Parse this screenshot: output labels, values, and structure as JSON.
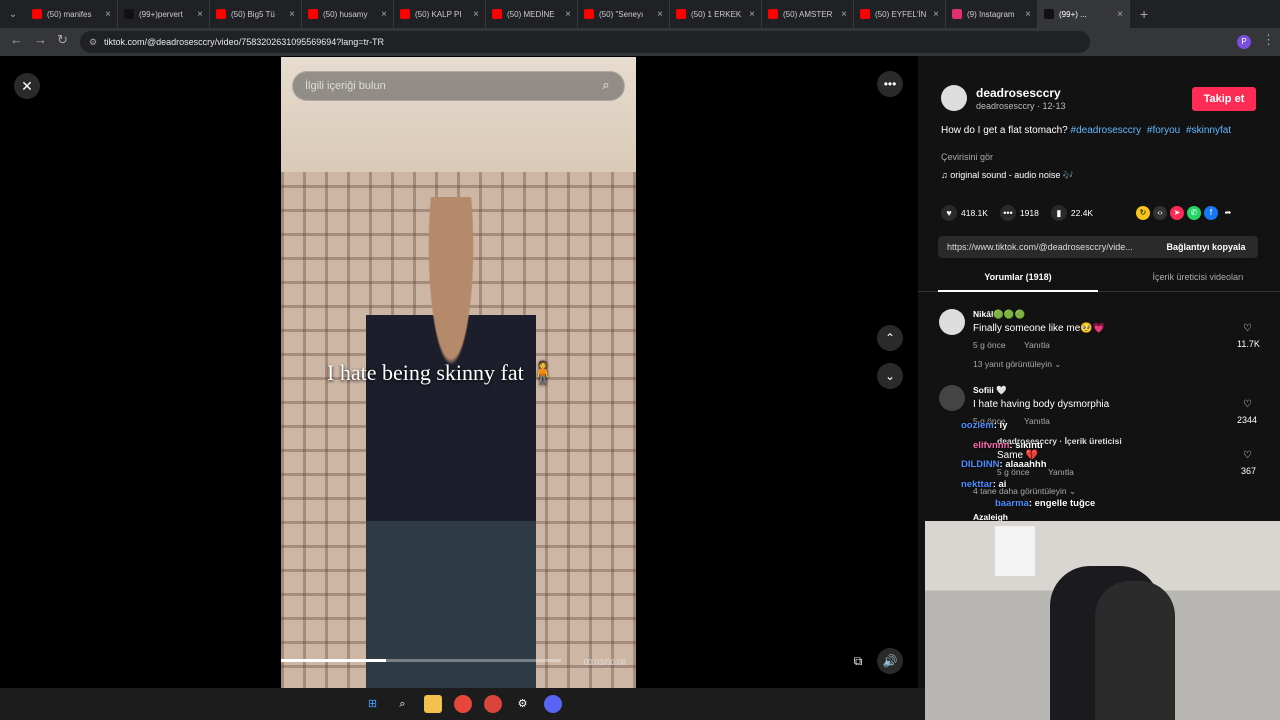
{
  "browser": {
    "tabs": [
      {
        "label": "(50) manifes",
        "color": "#ff0000"
      },
      {
        "label": "(99+)pervert",
        "color": "#111111"
      },
      {
        "label": "(50) Big5 Tü",
        "color": "#ff0000"
      },
      {
        "label": "(50) husamy",
        "color": "#ff0000"
      },
      {
        "label": "(50) KALP PI",
        "color": "#ff0000"
      },
      {
        "label": "(50) MEDİNE",
        "color": "#ff0000"
      },
      {
        "label": "(50) \"Seneyı",
        "color": "#ff0000"
      },
      {
        "label": "(50) 1 ERKEK",
        "color": "#ff0000"
      },
      {
        "label": "(50) AMSTER",
        "color": "#ff0000"
      },
      {
        "label": "(50) EYFEL'İN",
        "color": "#ff0000"
      },
      {
        "label": "(9) Instagram",
        "color": "#e1306c"
      },
      {
        "label": "(99+) ...",
        "color": "#111111"
      }
    ],
    "url": "tiktok.com/@deadrosesccry/video/7583202631095569694?lang=tr-TR"
  },
  "video": {
    "search_placeholder": "İlgili içeriği bulun",
    "caption": "I hate being skinny fat 🧍",
    "timecode": "00:03/00:08",
    "progress_fraction": 0.375
  },
  "profile": {
    "username": "deadrosesccry",
    "handle_date": "deadrosesccry · 12-13",
    "follow_label": "Takip et",
    "description": "How do I get a flat stomach?",
    "tags": [
      "#deadrosesccry",
      "#foryou",
      "#skinnyfat"
    ],
    "translate": "Çevirisini gör",
    "sound": "♫  original sound - audio noise 🎶",
    "likes": "418.1K",
    "comments": "1918",
    "saves": "22.4K",
    "link": "https://www.tiktok.com/@deadrosesccry/vide...",
    "copy_label": "Bağlantıyı kopyala",
    "tab_comments": "Yorumlar (1918)",
    "tab_creator": "İçerik üreticisi videoları"
  },
  "comments": [
    {
      "user": "Nikâl🟢🟢🟢",
      "text": "Finally someone like me🥺💗",
      "time": "5 g önce",
      "reply": "Yanıtla",
      "likes": "11.7K",
      "more": "13 yanıt görüntüleyin ⌄"
    },
    {
      "user": "Sofiii 🤍",
      "text": "I hate having body dysmorphia",
      "time": "5 g önce",
      "reply": "Yanıtla",
      "likes": "2344"
    },
    {
      "user": "deadrosesccry · İçerik üreticisi",
      "text": "Same 💔",
      "time": "5 g önce",
      "reply": "Yanıtla",
      "likes": "367",
      "more": "4 tane daha görüntüleyin ⌄"
    },
    {
      "user": "Azaleigh",
      "text": ""
    }
  ],
  "chat": [
    {
      "name": "oozlem",
      "msg": ": iy"
    },
    {
      "name": "elifvnnn",
      "msg": ": sıkıntı"
    },
    {
      "name": "DILDINN",
      "msg": ": alaaahhh"
    },
    {
      "name": "nekttar",
      "msg": ": ai"
    },
    {
      "name": "baarma",
      "msg": ": engelle tuğce"
    }
  ],
  "colors": {
    "accent": "#fe2c55",
    "tag": "#63b6ff",
    "panel": "#121212"
  }
}
